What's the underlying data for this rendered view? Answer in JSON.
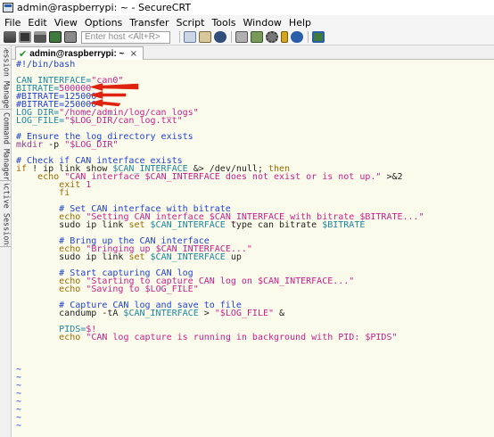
{
  "window": {
    "title": "admin@raspberrypi: ~ - SecureCRT"
  },
  "menu": [
    "File",
    "Edit",
    "View",
    "Options",
    "Transfer",
    "Script",
    "Tools",
    "Window",
    "Help"
  ],
  "toolbar": {
    "host_placeholder": "Enter host <Alt+R>"
  },
  "side_tabs": [
    "Session Manager",
    "Command Manager",
    "Active Sessions"
  ],
  "session_tab": {
    "label": "admin@raspberrypi: ~",
    "close_glyph": "×",
    "status": "connected"
  },
  "script_lines": [
    [
      [
        "comment",
        "#!/bin/bash"
      ]
    ],
    [
      [
        "plain",
        ""
      ]
    ],
    [
      [
        "vtl",
        "CAN_INTERFACE="
      ],
      [
        "str",
        "\"can0\""
      ]
    ],
    [
      [
        "vtl",
        "BITRATE="
      ],
      [
        "str",
        "500000"
      ]
    ],
    [
      [
        "comment",
        "#BITRATE=125000"
      ]
    ],
    [
      [
        "comment",
        "#BITRATE=250000"
      ]
    ],
    [
      [
        "vtl",
        "LOG_DIR="
      ],
      [
        "str",
        "\"/home/admin/log/can_logs\""
      ]
    ],
    [
      [
        "vtl",
        "LOG_FILE="
      ],
      [
        "str",
        "\"$LOG_DIR/can_log.txt\""
      ]
    ],
    [
      [
        "plain",
        ""
      ]
    ],
    [
      [
        "comment",
        "# Ensure the log directory exists"
      ]
    ],
    [
      [
        "cmd",
        "mkdir"
      ],
      [
        "plain",
        " -p "
      ],
      [
        "str",
        "\"$LOG_DIR\""
      ]
    ],
    [
      [
        "plain",
        ""
      ]
    ],
    [
      [
        "comment",
        "# Check if CAN interface exists"
      ]
    ],
    [
      [
        "kw",
        "if"
      ],
      [
        "plain",
        " ! ip link show "
      ],
      [
        "var",
        "$CAN_INTERFACE"
      ],
      [
        "plain",
        " &> /dev/null; "
      ],
      [
        "kw",
        "then"
      ]
    ],
    [
      [
        "plain",
        "    "
      ],
      [
        "kw",
        "echo"
      ],
      [
        "plain",
        " "
      ],
      [
        "str",
        "\"CAN interface $CAN_INTERFACE does not exist or is not up.\""
      ],
      [
        "plain",
        " >&2"
      ]
    ],
    [
      [
        "plain",
        "        "
      ],
      [
        "kw",
        "exit"
      ],
      [
        "plain",
        " "
      ],
      [
        "str",
        "1"
      ]
    ],
    [
      [
        "plain",
        "        "
      ],
      [
        "kw",
        "fi"
      ]
    ],
    [
      [
        "plain",
        ""
      ]
    ],
    [
      [
        "plain",
        "        "
      ],
      [
        "comment",
        "# Set CAN interface with bitrate"
      ]
    ],
    [
      [
        "plain",
        "        "
      ],
      [
        "kw",
        "echo"
      ],
      [
        "plain",
        " "
      ],
      [
        "str",
        "\"Setting CAN interface $CAN_INTERFACE with bitrate $BITRATE...\""
      ]
    ],
    [
      [
        "plain",
        "        sudo ip link "
      ],
      [
        "kw",
        "set"
      ],
      [
        "plain",
        " "
      ],
      [
        "var",
        "$CAN_INTERFACE"
      ],
      [
        "plain",
        " type can bitrate "
      ],
      [
        "var",
        "$BITRATE"
      ]
    ],
    [
      [
        "plain",
        ""
      ]
    ],
    [
      [
        "plain",
        "        "
      ],
      [
        "comment",
        "# Bring up the CAN interface"
      ]
    ],
    [
      [
        "plain",
        "        "
      ],
      [
        "kw",
        "echo"
      ],
      [
        "plain",
        " "
      ],
      [
        "str",
        "\"Bringing up $CAN_INTERFACE...\""
      ]
    ],
    [
      [
        "plain",
        "        sudo ip link "
      ],
      [
        "kw",
        "set"
      ],
      [
        "plain",
        " "
      ],
      [
        "var",
        "$CAN_INTERFACE"
      ],
      [
        "plain",
        " up"
      ]
    ],
    [
      [
        "plain",
        ""
      ]
    ],
    [
      [
        "plain",
        "        "
      ],
      [
        "comment",
        "# Start capturing CAN log"
      ]
    ],
    [
      [
        "plain",
        "        "
      ],
      [
        "kw",
        "echo"
      ],
      [
        "plain",
        " "
      ],
      [
        "str",
        "\"Starting to capture CAN log on $CAN_INTERFACE...\""
      ]
    ],
    [
      [
        "plain",
        "        "
      ],
      [
        "kw",
        "echo"
      ],
      [
        "plain",
        " "
      ],
      [
        "str",
        "\"Saving to $LOG_FILE\""
      ]
    ],
    [
      [
        "plain",
        ""
      ]
    ],
    [
      [
        "plain",
        "        "
      ],
      [
        "comment",
        "# Capture CAN log and save to file"
      ]
    ],
    [
      [
        "plain",
        "        candump -tA "
      ],
      [
        "var",
        "$CAN_INTERFACE"
      ],
      [
        "plain",
        " > "
      ],
      [
        "str",
        "\"$LOG_FILE\""
      ],
      [
        "plain",
        " &"
      ]
    ],
    [
      [
        "plain",
        ""
      ]
    ],
    [
      [
        "plain",
        "        "
      ],
      [
        "vtl",
        "PIDS="
      ],
      [
        "str",
        "$!"
      ]
    ],
    [
      [
        "plain",
        "        "
      ],
      [
        "kw",
        "echo"
      ],
      [
        "plain",
        " "
      ],
      [
        "str",
        "\"CAN log capture is running in background with PID: $PIDS\""
      ]
    ]
  ],
  "empty_line_marker": "~",
  "colors": {
    "terminal_bg": "#fbfbeb",
    "comment": "#1f3fd6",
    "string": "#c81f8a",
    "variable": "#1e86a0",
    "keyword": "#9a6a00",
    "arrow": "#e0230f"
  }
}
